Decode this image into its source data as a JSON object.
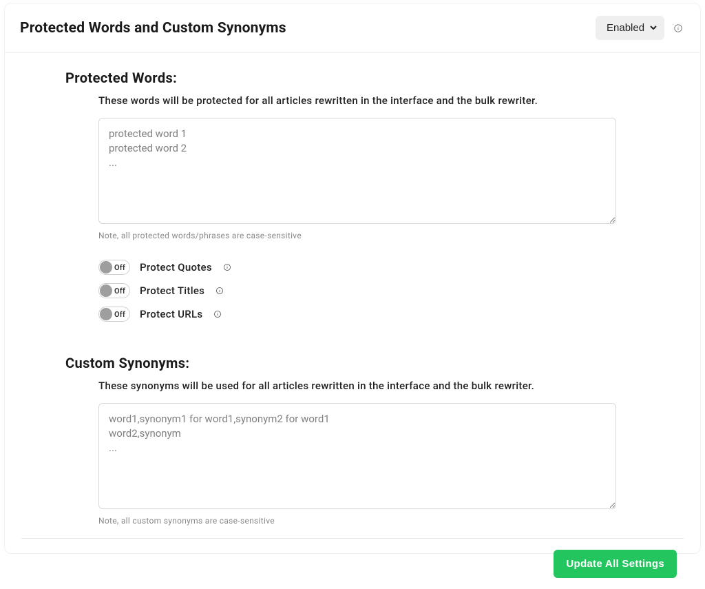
{
  "header": {
    "title": "Protected Words and Custom Synonyms",
    "status_select": {
      "selected": "Enabled",
      "options": [
        "Enabled"
      ]
    }
  },
  "protected_words": {
    "title": "Protected Words:",
    "description": "These words will be protected for all articles rewritten in the interface and the bulk rewriter.",
    "textarea_value": "",
    "textarea_placeholder": "protected word 1\nprotected word 2\n...",
    "note": "Note, all protected words/phrases are case-sensitive",
    "toggles": [
      {
        "state_text": "Off",
        "label": "Protect Quotes"
      },
      {
        "state_text": "Off",
        "label": "Protect Titles"
      },
      {
        "state_text": "Off",
        "label": "Protect URLs"
      }
    ]
  },
  "custom_synonyms": {
    "title": "Custom Synonyms:",
    "description": "These synonyms will be used for all articles rewritten in the interface and the bulk rewriter.",
    "textarea_value": "",
    "textarea_placeholder": "word1,synonym1 for word1,synonym2 for word1\nword2,synonym\n...",
    "note": "Note, all custom synonyms are case-sensitive"
  },
  "footer": {
    "update_button": "Update All Settings"
  }
}
